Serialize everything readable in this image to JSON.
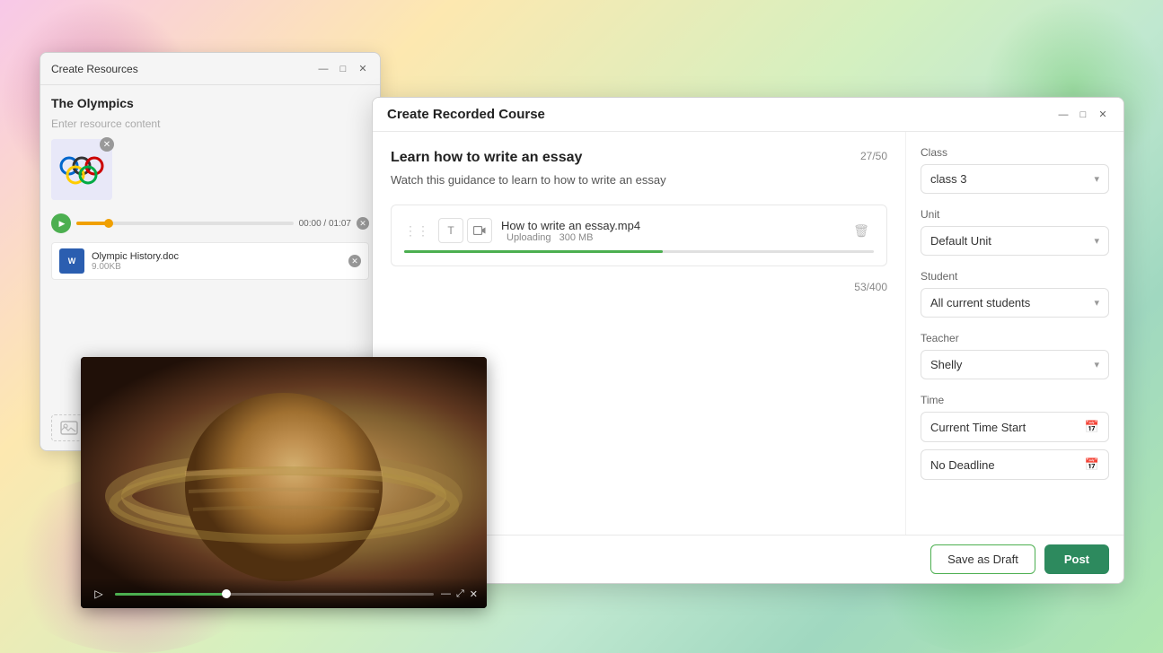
{
  "background": {
    "colors": [
      "#f8c8e8",
      "#fde8b0",
      "#d4f0c0",
      "#c0e8d0",
      "#a0d8c0"
    ]
  },
  "createResourcesWindow": {
    "title": "Create Resources",
    "innerTitle": "The Olympics",
    "placeholder": "Enter resource content",
    "audioTime": "00:00 / 01:07",
    "file": {
      "name": "Olympic History.doc",
      "size": "9.00KB",
      "type": "W"
    },
    "controls": {
      "minimize": "—",
      "maximize": "□",
      "close": "✕"
    }
  },
  "videoPlayer": {
    "controls": {
      "play": "▷",
      "minimize": "—",
      "restore": "⤢",
      "close": "✕"
    }
  },
  "createRecordedCourse": {
    "title": "Create Recorded Course",
    "controls": {
      "minimize": "—",
      "maximize": "□",
      "close": "✕"
    },
    "courseTitle": "Learn how to write an essay",
    "charCount": "27/50",
    "courseDesc": "Watch this guidance to learn to how to write an essay",
    "upload": {
      "filename": "How to write an essay.mp4",
      "status": "Uploading",
      "size": "300 MB",
      "progressWidth": "55%"
    },
    "descCharCount": "53/400",
    "sidebar": {
      "classLabel": "Class",
      "classValue": "class 3",
      "unitLabel": "Unit",
      "unitValue": "Default Unit",
      "studentLabel": "Student",
      "studentValue": "All current students",
      "teacherLabel": "Teacher",
      "teacherValue": "Shelly",
      "timeLabel": "Time",
      "timeStart": "Current Time Start",
      "timeEnd": "No Deadline"
    },
    "footer": {
      "saveDraft": "Save as Draft",
      "post": "Post"
    }
  }
}
